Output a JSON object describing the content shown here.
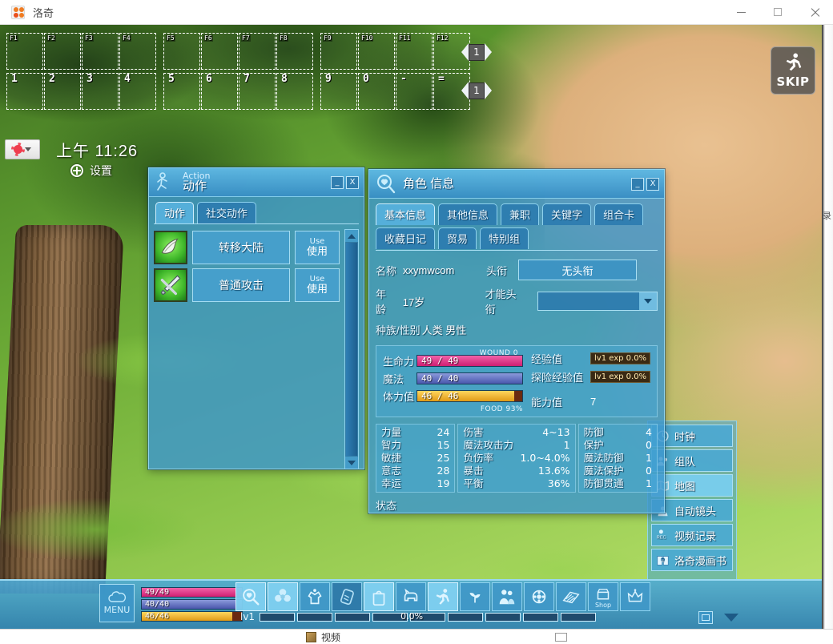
{
  "os_window": {
    "title": "洛奇",
    "app_icon": "mabinogi-logo-icon",
    "minimize": "—",
    "maximize": "▭",
    "close": "✕"
  },
  "taskbar": {
    "item_label": "视频",
    "item_icon": "video-file-icon"
  },
  "quickslots": {
    "function_row": [
      "F1",
      "F2",
      "F3",
      "F4",
      "F5",
      "F6",
      "F7",
      "F8",
      "F9",
      "F10",
      "F11",
      "F12"
    ],
    "number_row": [
      "1",
      "2",
      "3",
      "4",
      "5",
      "6",
      "7",
      "8",
      "9",
      "0",
      "-",
      "="
    ],
    "page_top": "1",
    "page_bottom": "1"
  },
  "clock": {
    "weather_icon": "sun-icon",
    "dropdown_icon": "chevron-down-icon",
    "time": "上午 11:26",
    "settings_icon": "plus-circle-icon",
    "settings_label": "设置"
  },
  "skip": {
    "icon": "running-person-icon",
    "label": "SKIP"
  },
  "action_window": {
    "icon": "running-person-icon",
    "title_en": "Action",
    "title_cn": "动作",
    "minimize": "_",
    "close": "X",
    "tabs": [
      {
        "label": "动作",
        "active": true
      },
      {
        "label": "社交动作",
        "active": false
      }
    ],
    "items": [
      {
        "icon": "wing-icon",
        "name": "转移大陆",
        "use_en": "Use",
        "use_cn": "使用"
      },
      {
        "icon": "sword-icon",
        "name": "普通攻击",
        "use_en": "Use",
        "use_cn": "使用"
      }
    ],
    "scrollbar": {
      "up": "▲",
      "down": "▼"
    }
  },
  "character_window": {
    "icon": "character-info-icon",
    "title": "角色 信息",
    "minimize": "_",
    "close": "X",
    "tabs_row1": [
      {
        "label": "基本信息",
        "active": true
      },
      {
        "label": "其他信息",
        "active": false
      },
      {
        "label": "兼职",
        "active": false
      },
      {
        "label": "关键字",
        "active": false
      },
      {
        "label": "组合卡",
        "active": false
      }
    ],
    "tabs_row2": [
      {
        "label": "收藏日记",
        "active": false
      },
      {
        "label": "贸易",
        "active": false
      },
      {
        "label": "特别组",
        "active": false
      }
    ],
    "fields": {
      "name_label": "名称",
      "name_value": "xxymwcom",
      "title_label": "头衔",
      "title_value": "无头衔",
      "age_label": "年龄",
      "age_value": "17岁",
      "talent_title_label": "才能头衔",
      "talent_title_value": "",
      "race_gender_label": "种族/性别",
      "race_gender_value": "人类 男性"
    },
    "vitals": {
      "wound_label": "WOUND",
      "wound_value": "0",
      "hp_label": "生命力",
      "hp_value": "49 / 49",
      "mp_label": "魔法",
      "mp_value": "40 / 40",
      "sp_label": "体力值",
      "sp_value": "46 / 46",
      "food_label": "FOOD",
      "food_value": "93%",
      "exp_label": "经验值",
      "exp_value": "lv1 exp 0.0%",
      "explore_exp_label": "探险经验值",
      "explore_exp_value": "lv1 exp 0.0%",
      "ability_label": "能力值",
      "ability_value": "7"
    },
    "stats_col1": [
      {
        "key": "力量",
        "value": "24"
      },
      {
        "key": "智力",
        "value": "15"
      },
      {
        "key": "敏捷",
        "value": "25"
      },
      {
        "key": "意志",
        "value": "28"
      },
      {
        "key": "幸运",
        "value": "19"
      }
    ],
    "stats_col2": [
      {
        "key": "伤害",
        "value": "4~13"
      },
      {
        "key": "魔法攻击力",
        "value": "1"
      },
      {
        "key": "负伤率",
        "value": "1.0~4.0%"
      },
      {
        "key": "暴击",
        "value": "13.6%"
      },
      {
        "key": "平衡",
        "value": "36%"
      }
    ],
    "stats_col3": [
      {
        "key": "防御",
        "value": "4"
      },
      {
        "key": "保护",
        "value": "0"
      },
      {
        "key": "魔法防御",
        "value": "1"
      },
      {
        "key": "魔法保护",
        "value": "0"
      },
      {
        "key": "防御贯通",
        "value": "1"
      }
    ],
    "status_label": "状态"
  },
  "menu_panel": {
    "items": [
      {
        "label": "时钟",
        "icon": "clock-icon",
        "selected": false
      },
      {
        "label": "组队",
        "icon": "party-icon",
        "selected": false
      },
      {
        "label": "地图",
        "icon": "map-icon",
        "selected": true
      },
      {
        "label": "自动镜头",
        "icon": "camera-icon",
        "selected": false
      },
      {
        "label": "视频记录",
        "icon": "rec-icon",
        "selected": false
      },
      {
        "label": "洛奇漫画书",
        "icon": "comic-book-icon",
        "selected": false
      }
    ]
  },
  "hud": {
    "menu_button_label": "MENU",
    "menu_button_icon": "cloud-menu-icon",
    "hp": "49/49",
    "mp": "40/40",
    "sp": "46/46",
    "level_label": "lv1",
    "exp_percent": "0.0%",
    "icons": [
      {
        "name": "character-info-icon",
        "state": "highlight"
      },
      {
        "name": "skills-icon",
        "state": "highlight"
      },
      {
        "name": "equipment-icon",
        "state": "normal"
      },
      {
        "name": "quest-scroll-icon",
        "state": "dim"
      },
      {
        "name": "inventory-bag-icon",
        "state": "highlight"
      },
      {
        "name": "pet-icon",
        "state": "normal"
      },
      {
        "name": "action-icon",
        "state": "highlight"
      },
      {
        "name": "plant-icon",
        "state": "normal"
      },
      {
        "name": "party-people-icon",
        "state": "normal"
      },
      {
        "name": "guild-icon",
        "state": "normal"
      },
      {
        "name": "book-icon",
        "state": "normal"
      },
      {
        "name": "shop-icon",
        "state": "normal",
        "label": "Shop"
      },
      {
        "name": "premium-crown-icon",
        "state": "normal"
      }
    ],
    "collapse_icon": "panel-icon",
    "dropdown_icon": "chevron-down-icon"
  },
  "colors": {
    "window_blue": "#3d96cd",
    "window_border": "#8fd4ef",
    "hp_bar": "#cf1f72",
    "mp_bar": "#4a57ad",
    "sp_bar": "#e09a16",
    "exp_bar": "#3a2a14",
    "accent_highlight": "#80d0f0"
  }
}
